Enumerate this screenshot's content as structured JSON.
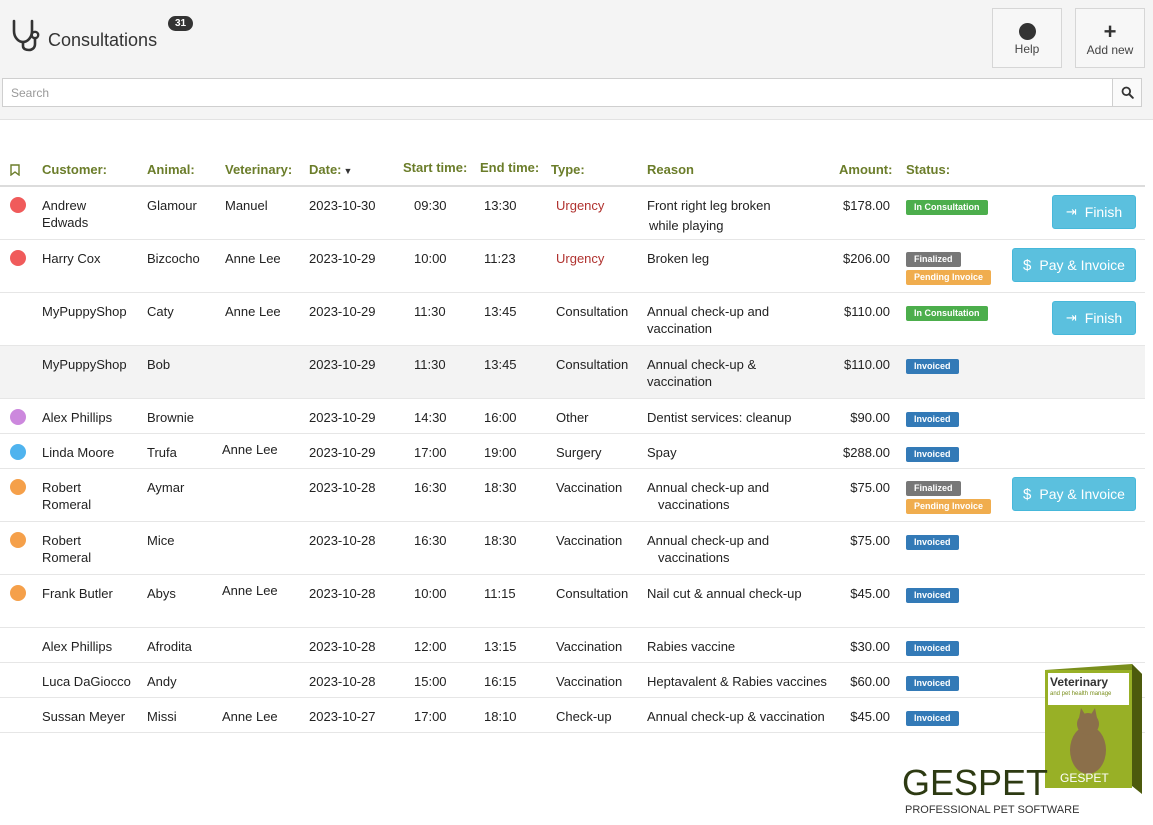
{
  "header": {
    "title": "Consultations",
    "count": "31",
    "help_label": "Help",
    "add_label": "Add new"
  },
  "search": {
    "placeholder": "Search"
  },
  "columns": {
    "customer": "Customer:",
    "animal": "Animal:",
    "veterinary": "Veterinary:",
    "date": "Date:",
    "start": "Start time:",
    "end": "End time:",
    "type": "Type:",
    "reason": "Reason",
    "amount": "Amount:",
    "status": "Status:"
  },
  "rows": [
    {
      "dot": "#f05b5b",
      "customer": [
        "Andrew",
        "Edwads"
      ],
      "animal": "Glamour",
      "vet": "Manuel",
      "date": "2023-10-30",
      "start": "09:30",
      "end": "13:30",
      "type": "Urgency",
      "reason": [
        "Front right leg broken",
        "while playing"
      ],
      "amount": "$178.00",
      "status": [
        "In Consultation"
      ],
      "action": "Finish"
    },
    {
      "dot": "#f05b5b",
      "customer": [
        "Harry Cox"
      ],
      "animal": "Bizcocho",
      "vet": "Anne Lee",
      "date": "2023-10-29",
      "start": "10:00",
      "end": "11:23",
      "type": "Urgency",
      "reason": [
        "Broken leg"
      ],
      "amount": "$206.00",
      "status": [
        "Finalized",
        "Pending Invoice"
      ],
      "action": "Pay & Invoice"
    },
    {
      "dot": "",
      "customer": [
        "MyPuppyShop"
      ],
      "animal": "Caty",
      "vet": "Anne Lee",
      "date": "2023-10-29",
      "start": "11:30",
      "end": "13:45",
      "type": "Consultation",
      "reason": [
        "Annual check-up and",
        "vaccination"
      ],
      "amount": "$110.00",
      "status": [
        "In Consultation"
      ],
      "action": "Finish"
    },
    {
      "dot": "",
      "customer": [
        "MyPuppyShop"
      ],
      "animal": "Bob",
      "vet": "",
      "date": "2023-10-29",
      "start": "11:30",
      "end": "13:45",
      "type": "Consultation",
      "reason": [
        "Annual check-up &",
        "vaccination"
      ],
      "amount": "$110.00",
      "status": [
        "Invoiced"
      ],
      "action": ""
    },
    {
      "dot": "#cc88dd",
      "customer": [
        "Alex Phillips"
      ],
      "animal": "Brownie",
      "vet": "",
      "date": "2023-10-29",
      "start": "14:30",
      "end": "16:00",
      "type": "Other",
      "reason": [
        "Dentist services: cleanup"
      ],
      "amount": "$90.00",
      "status": [
        "Invoiced"
      ],
      "action": ""
    },
    {
      "dot": "#4fb3ee",
      "customer": [
        "Linda Moore"
      ],
      "animal": "Trufa",
      "vet": "Anne Lee",
      "date": "2023-10-29",
      "start": "17:00",
      "end": "19:00",
      "type": "Surgery",
      "reason": [
        "Spay"
      ],
      "amount": "$288.00",
      "status": [
        "Invoiced"
      ],
      "action": ""
    },
    {
      "dot": "#f5a04a",
      "customer": [
        "Robert",
        "Romeral"
      ],
      "animal": "Aymar",
      "vet": "",
      "date": "2023-10-28",
      "start": "16:30",
      "end": "18:30",
      "type": "Vaccination",
      "reason": [
        "Annual check-up and",
        "vaccinations"
      ],
      "amount": "$75.00",
      "status": [
        "Finalized",
        "Pending Invoice"
      ],
      "action": "Pay & Invoice"
    },
    {
      "dot": "#f5a04a",
      "customer": [
        "Robert",
        "Romeral"
      ],
      "animal": "Mice",
      "vet": "",
      "date": "2023-10-28",
      "start": "16:30",
      "end": "18:30",
      "type": "Vaccination",
      "reason": [
        "Annual check-up and",
        "vaccinations"
      ],
      "amount": "$75.00",
      "status": [
        "Invoiced"
      ],
      "action": ""
    },
    {
      "dot": "#f5a04a",
      "customer": [
        "Frank Butler"
      ],
      "animal": "Abys",
      "vet": "Anne Lee",
      "date": "2023-10-28",
      "start": "10:00",
      "end": "11:15",
      "type": "Consultation",
      "reason": [
        "Nail cut & annual check-up"
      ],
      "amount": "$45.00",
      "status": [
        "Invoiced"
      ],
      "action": ""
    },
    {
      "dot": "",
      "customer": [
        "Alex Phillips"
      ],
      "animal": "Afrodita",
      "vet": "",
      "date": "2023-10-28",
      "start": "12:00",
      "end": "13:15",
      "type": "Vaccination",
      "reason": [
        "Rabies vaccine"
      ],
      "amount": "$30.00",
      "status": [
        "Invoiced"
      ],
      "action": ""
    },
    {
      "dot": "",
      "customer": [
        "Luca DaGiocco"
      ],
      "animal": "Andy",
      "vet": "",
      "date": "2023-10-28",
      "start": "15:00",
      "end": "16:15",
      "type": "Vaccination",
      "reason": [
        "Heptavalent & Rabies vaccines"
      ],
      "amount": "$60.00",
      "status": [
        "Invoiced"
      ],
      "action": ""
    },
    {
      "dot": "",
      "customer": [
        "Sussan Meyer"
      ],
      "animal": "Missi",
      "vet": "Anne Lee",
      "date": "2023-10-27",
      "start": "17:00",
      "end": "18:10",
      "type": "Check-up",
      "reason": [
        "Annual check-up & vaccination"
      ],
      "amount": "$45.00",
      "status": [
        "Invoiced"
      ],
      "action": ""
    }
  ],
  "status_colors": {
    "In Consultation": "#4cae4c",
    "Finalized": "#777777",
    "Pending Invoice": "#f0ad4e",
    "Invoiced": "#337ab7"
  },
  "logo": {
    "box_title": "Veterinary",
    "box_subtitle": "and pet health manage",
    "brand": "GESPET",
    "tagline": "PROFESSIONAL PET SOFTWARE"
  }
}
